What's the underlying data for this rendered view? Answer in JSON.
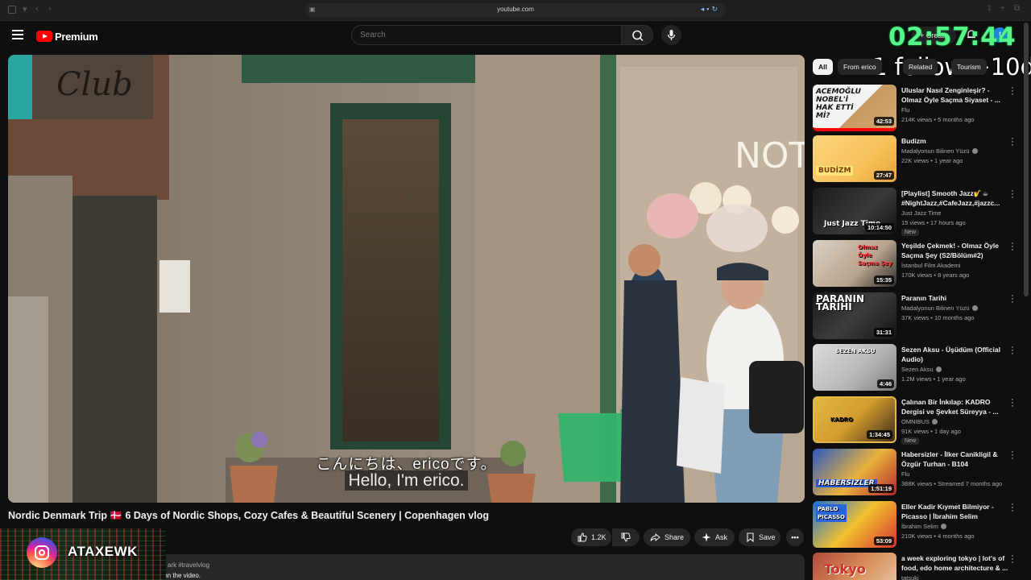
{
  "browser": {
    "url": "youtube.com"
  },
  "header": {
    "logo_text": "Premium",
    "search_placeholder": "Search",
    "create_label": "Create",
    "avatar_letter": "t"
  },
  "overlay": {
    "timer": "02:57:44",
    "follow_text": "1 follow +10dk",
    "instagram_handle": "ATAXEWK"
  },
  "video": {
    "subtitle_jp": "こんにちは、ericoです。",
    "subtitle_en": "Hello, I'm erico.",
    "title": "Nordic Denmark Trip 🇩🇰 6 Days of Nordic Shops, Cozy Cafes & Beautiful Scenery | Copenhagen vlog",
    "likes": "1.2K",
    "share_label": "Share",
    "ask_label": "Ask",
    "save_label": "Save",
    "description_tags": "ark #travelvlog",
    "description_line": "Please enable subtitles by clicking the CC button on the video."
  },
  "chips": [
    "All",
    "From erico",
    "Related",
    "Tourism"
  ],
  "recommendations": [
    {
      "title": "Uluslar Nasıl Zenginleşir? - Olmaz Öyle Saçma Siyaset - ...",
      "channel": "Flu",
      "verified": false,
      "meta": "214K views • 5 months ago",
      "duration": "42:53",
      "thumb_text": "ACEMOĞLU NOBEL'İ HAK ETTİ Mİ?",
      "new": false
    },
    {
      "title": "Budizm",
      "channel": "Madalyonun Bilinen Yüzü",
      "verified": true,
      "meta": "22K views • 1 year ago",
      "duration": "27:47",
      "thumb_text": "BUDİZM",
      "new": false
    },
    {
      "title": "[Playlist] Smooth Jazz🎷☕ #NightJazz,#CafeJazz,#jazzc...",
      "channel": "Just Jazz Time",
      "verified": false,
      "meta": "15 views • 17 hours ago",
      "duration": "10:14:50",
      "thumb_text": "Just Jazz Time",
      "new": true
    },
    {
      "title": "Yeşilde Çekmek! - Olmaz Öyle Saçma Şey (S2/Bölüm#2)",
      "channel": "İstanbul Film Akademi",
      "verified": false,
      "meta": "170K views • 8 years ago",
      "duration": "15:35",
      "thumb_text": "Olmaz Öyle Saçma Şey",
      "new": false
    },
    {
      "title": "Paranın Tarihi",
      "channel": "Madalyonun Bilinen Yüzü",
      "verified": true,
      "meta": "37K views • 10 months ago",
      "duration": "31:31",
      "thumb_text": "PARANIN TARİHİ",
      "new": false
    },
    {
      "title": "Sezen Aksu - Üşüdüm (Official Audio)",
      "channel": "Sezen Aksu",
      "verified": true,
      "meta": "1.2M views • 1 year ago",
      "duration": "4:46",
      "thumb_text": "SEZEN AKSU",
      "new": false
    },
    {
      "title": "Çalınan Bir İnkılap: KADRO Dergisi ve Şevket Süreyya - ...",
      "channel": "OMNIBUS",
      "verified": true,
      "meta": "91K views • 1 day ago",
      "duration": "1:34:45",
      "thumb_text": "KADRO",
      "new": true
    },
    {
      "title": "Habersizler - İlker Canikligil & Özgür Turhan - B104",
      "channel": "Flu",
      "verified": false,
      "meta": "388K views • Streamed 7 months ago",
      "duration": "1:51:19",
      "thumb_text": "HABERSIZLER",
      "new": false
    },
    {
      "title": "Eller Kadir Kıymet Bilmiyor - Picasso | İbrahim Selim",
      "channel": "İbrahim Selim",
      "verified": true,
      "meta": "210K views • 4 months ago",
      "duration": "53:09",
      "thumb_text": "PABLO PICASSO",
      "new": false
    },
    {
      "title": "a week exploring tokyo | lot's of food, edo home architecture & ...",
      "channel": "tatsuki",
      "verified": false,
      "meta": "",
      "duration": "",
      "thumb_text": "Tokyo",
      "new": false
    }
  ]
}
